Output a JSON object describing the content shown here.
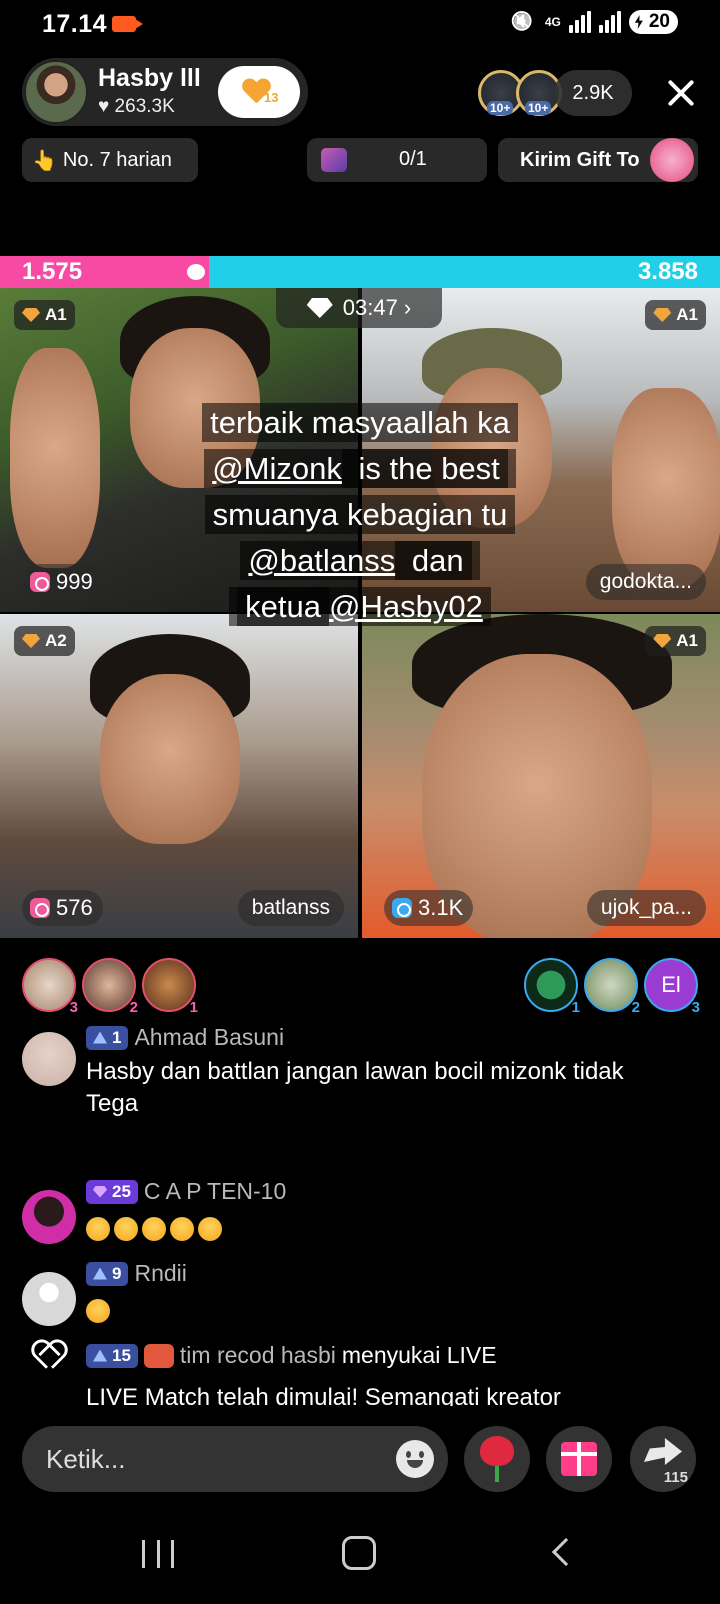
{
  "status_bar": {
    "time": "17.14",
    "network": "4G",
    "battery": "20"
  },
  "host": {
    "name": "Hasby lll",
    "likes": "♥ 263.3K",
    "follow_count": "13"
  },
  "viewers": {
    "badge_1": "10+",
    "badge_2": "10+",
    "count": "2.9K"
  },
  "chips": {
    "rank": "No. 7 harian",
    "goal": "0/1",
    "gift": "Kirim Gift To"
  },
  "battle": {
    "left_score": "1.575",
    "right_score": "3.858",
    "left_ratio": 0.29,
    "timer": "03:47 ›"
  },
  "tiles": [
    {
      "tier": "A1",
      "score": "999",
      "name": "",
      "score_color": "pink"
    },
    {
      "tier": "A1",
      "score": "",
      "name": "godokta...",
      "score_color": ""
    },
    {
      "tier": "A2",
      "score": "576",
      "name": "batlanss",
      "score_color": "pink"
    },
    {
      "tier": "A1",
      "score": "3.1K",
      "name": "ujok_pa...",
      "score_color": "blue"
    }
  ],
  "caption": {
    "line1": "terbaik masyaallah ka",
    "line2_mention": "@Mizonk",
    "line2_rest": " is the best",
    "line3": "smuanya kebagian tu",
    "line4_mention": "@batlanss",
    "line4_rest": " dan",
    "line5_prefix": "ketua",
    "line5_mention": "@Hasby02"
  },
  "gifters_left": [
    {
      "rank": "3"
    },
    {
      "rank": "2"
    },
    {
      "rank": "1"
    }
  ],
  "gifters_right": [
    {
      "rank": "1",
      "label": ""
    },
    {
      "rank": "2",
      "label": ""
    },
    {
      "rank": "3",
      "label": "El"
    }
  ],
  "chat": [
    {
      "level": "1",
      "user": "Ahmad Basuni",
      "text": "Hasby dan battlan jangan lawan bocil mizonk tidak Tega"
    },
    {
      "level": "25",
      "user": "C A P TEN-10",
      "text": ""
    },
    {
      "level": "9",
      "user": "Rndii",
      "text": ""
    },
    {
      "level": "15",
      "user": "tim recod hasbi",
      "text": "menyukai LIVE"
    },
    {
      "text": "LIVE Match telah dimulai! Semangati kreator"
    }
  ],
  "input": {
    "placeholder": "Ketik..."
  },
  "share_count": "115",
  "colors": {
    "battle_pink": "#f74aa2",
    "battle_cyan": "#22cfe8",
    "accent_orange": "#f4a534"
  }
}
